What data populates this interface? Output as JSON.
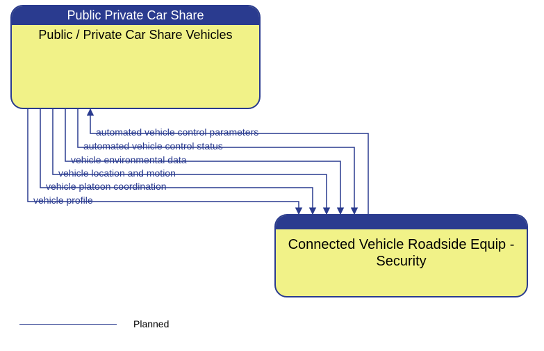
{
  "boxes": {
    "source": {
      "header": "Public Private Car Share",
      "body": "Public / Private Car Share Vehicles"
    },
    "target": {
      "body": "Connected Vehicle Roadside Equip - Security"
    }
  },
  "flows": {
    "f1": "automated vehicle control parameters",
    "f2": "automated vehicle control status",
    "f3": "vehicle environmental data",
    "f4": "vehicle location and motion",
    "f5": "vehicle platoon coordination",
    "f6": "vehicle profile"
  },
  "legend": {
    "planned": "Planned"
  }
}
